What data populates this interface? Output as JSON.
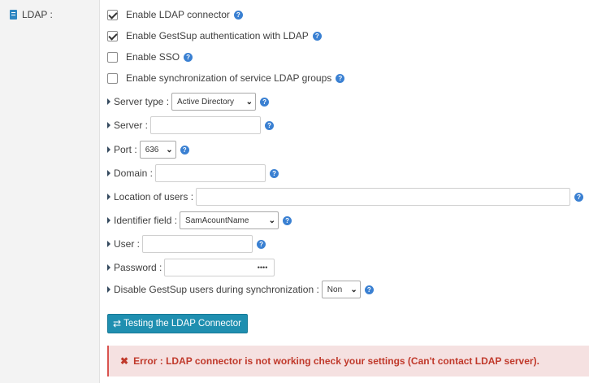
{
  "section": {
    "label": "LDAP :"
  },
  "checkboxes": [
    {
      "label": "Enable LDAP connector",
      "checked": true
    },
    {
      "label": "Enable GestSup authentication with LDAP",
      "checked": true
    },
    {
      "label": "Enable SSO",
      "checked": false
    },
    {
      "label": "Enable synchronization of service LDAP groups",
      "checked": false
    }
  ],
  "fields": {
    "server_type": {
      "label": "Server type :",
      "value": "Active Directory"
    },
    "server": {
      "label": "Server :",
      "value": ""
    },
    "port": {
      "label": "Port :",
      "value": "636"
    },
    "domain": {
      "label": "Domain :",
      "value": ""
    },
    "location_of_users": {
      "label": "Location of users :",
      "value": ""
    },
    "identifier_field": {
      "label": "Identifier field :",
      "value": "SamAcountName"
    },
    "user": {
      "label": "User :",
      "value": ""
    },
    "password": {
      "label": "Password :",
      "value": "••••"
    },
    "disable_users": {
      "label": "Disable GestSup users during synchronization :",
      "value": "Non"
    }
  },
  "button": {
    "label": "Testing the LDAP Connector",
    "icon": "swap-icon"
  },
  "alert": {
    "icon": "✖",
    "text": "Error : LDAP connector is not working check your settings (Can't contact LDAP server)."
  },
  "colors": {
    "accent": "#1f8fb0",
    "help": "#3a80d2",
    "error_text": "#c0392b",
    "error_bg": "#f5e1e1"
  }
}
